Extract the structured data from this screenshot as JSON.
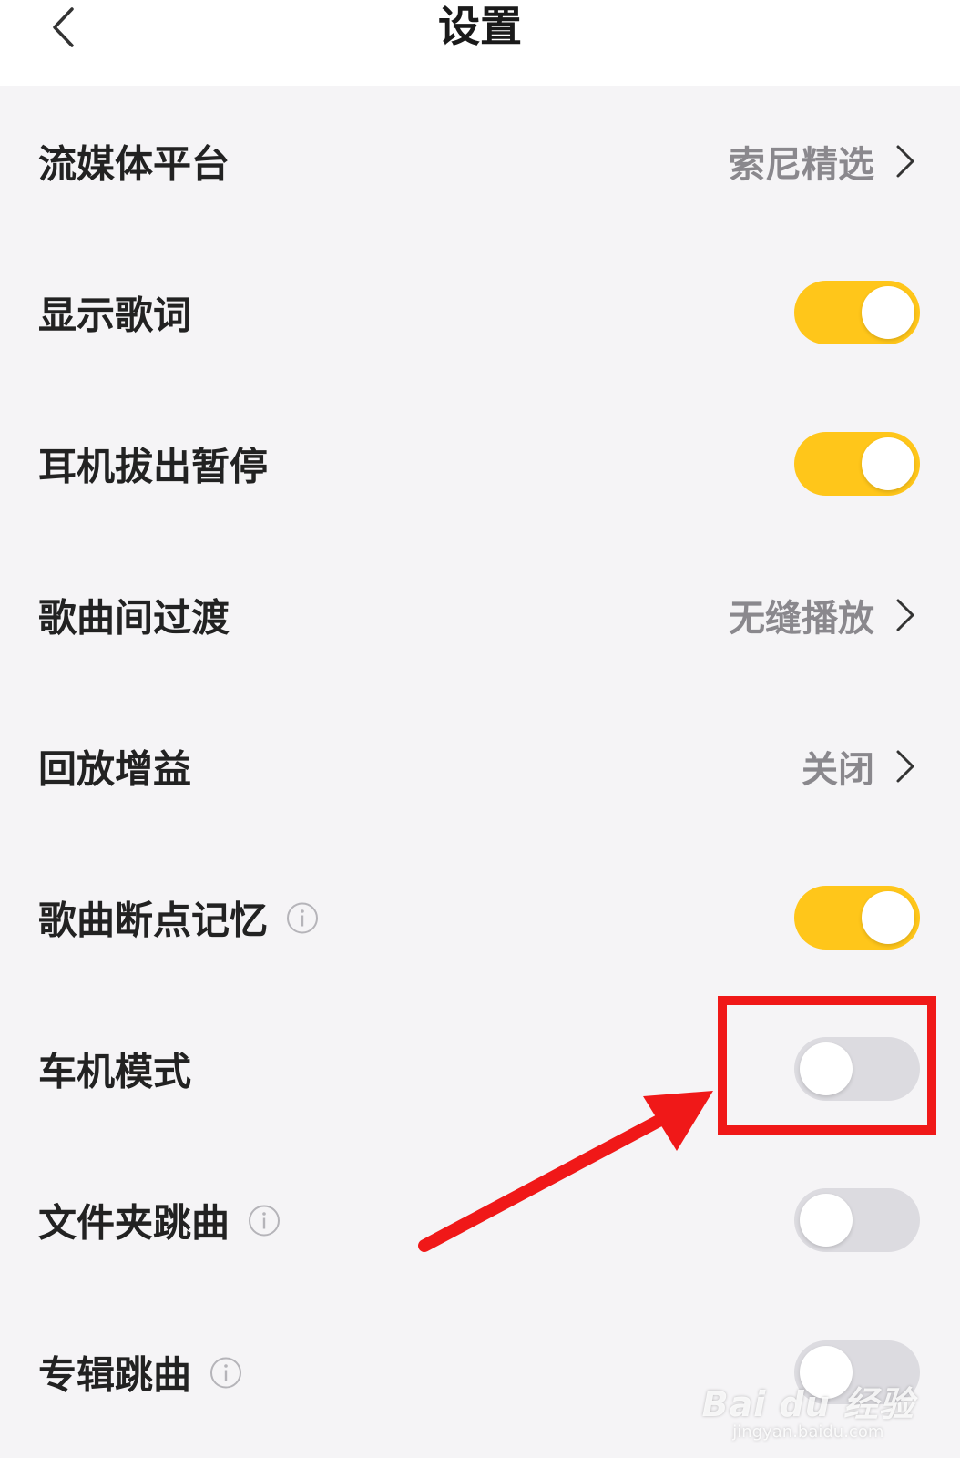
{
  "header": {
    "title": "设置"
  },
  "rows": [
    {
      "label": "流媒体平台",
      "value": "索尼精选"
    },
    {
      "label": "显示歌词",
      "toggle": "on"
    },
    {
      "label": "耳机拔出暂停",
      "toggle": "on"
    },
    {
      "label": "歌曲间过渡",
      "value": "无缝播放"
    },
    {
      "label": "回放增益",
      "value": "关闭"
    },
    {
      "label": "歌曲断点记忆",
      "toggle": "on",
      "info": true
    },
    {
      "label": "车机模式",
      "toggle": "off"
    },
    {
      "label": "文件夹跳曲",
      "toggle": "off",
      "info": true
    },
    {
      "label": "专辑跳曲",
      "toggle": "off",
      "info": true
    }
  ],
  "watermark": {
    "logo": "Bai du 经验",
    "url": "jingyan.baidu.com"
  },
  "colors": {
    "toggle_on": "#ffc61a",
    "toggle_off": "#dcdbe0",
    "highlight": "#f01818"
  }
}
